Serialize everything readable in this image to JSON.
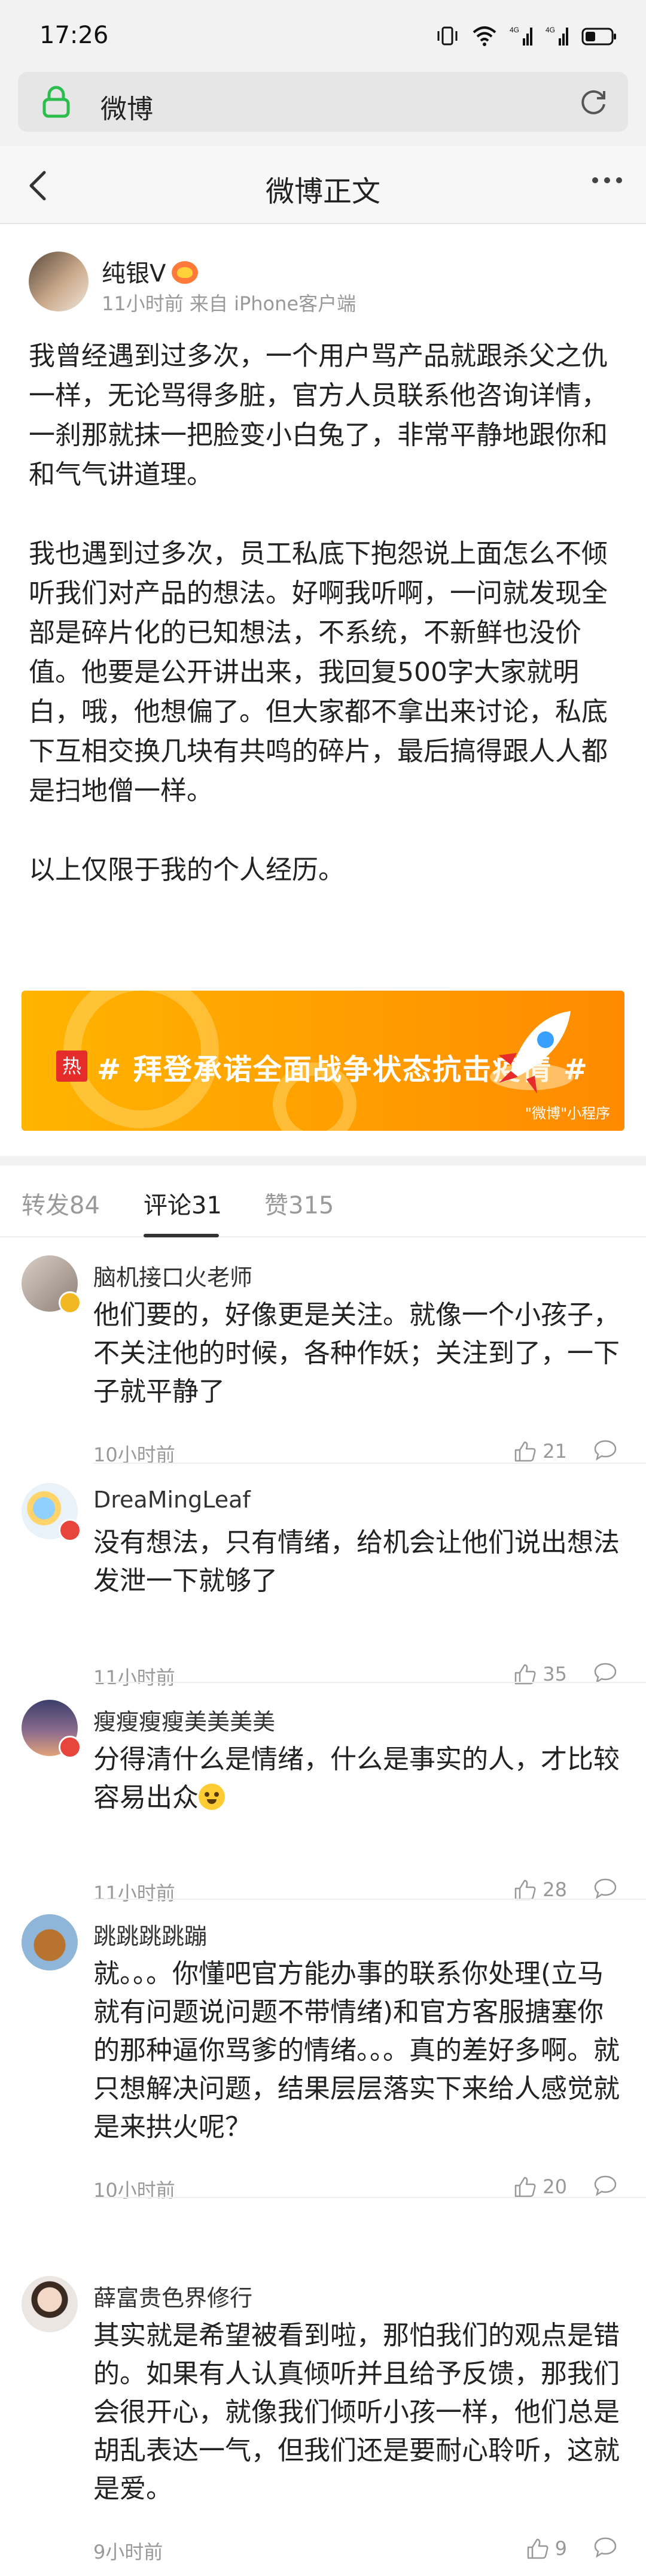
{
  "status_bar": {
    "time": "17:26",
    "signal_a": "4G",
    "signal_b": "4G"
  },
  "browser": {
    "url_text": "微博"
  },
  "nav": {
    "title": "微博正文"
  },
  "post": {
    "author": "纯银V",
    "meta": "11小时前 来自 iPhone客户端",
    "paragraphs": [
      "我曾经遇到过多次，一个用户骂产品就跟杀父之仇一样，无论骂得多脏，官方人员联系他咨询详情，一刹那就抹一把脸变小白兔了，非常平静地跟你和和气气讲道理。",
      "我也遇到过多次，员工私底下抱怨说上面怎么不倾听我们对产品的想法。好啊我听啊，一问就发现全部是碎片化的已知想法，不系统，不新鲜也没价值。他要是公开讲出来，我回复500字大家就明白，哦，他想偏了。但大家都不拿出来讨论，私底下互相交换几块有共鸣的碎片，最后搞得跟人人都是扫地僧一样。",
      "以上仅限于我的个人经历。"
    ]
  },
  "banner": {
    "hot_tag": "热",
    "text": "# 拜登承诺全面战争状态抗击疫情 #",
    "footer": "\"微博\"小程序"
  },
  "tabs": {
    "repost": "转发84",
    "comment": "评论31",
    "like": "赞315"
  },
  "comments": [
    {
      "name": "脑机接口火老师",
      "text": "他们要的，好像更是关注。就像一个小孩子，不关注他的时候，各种作妖；关注到了，一下子就平静了",
      "time": "10小时前",
      "likes": "21"
    },
    {
      "name": "DreaMingLeaf",
      "text": "没有想法，只有情绪，给机会让他们说出想法发泄一下就够了",
      "time": "11小时前",
      "likes": "35"
    },
    {
      "name": "瘦瘦瘦瘦美美美美",
      "text": "分得清什么是情绪，什么是事实的人，才比较容易出众",
      "time": "11小时前",
      "likes": "28"
    },
    {
      "name": "跳跳跳跳蹦",
      "text": "就。。。你懂吧官方能办事的联系你处理(立马就有问题说问题不带情绪)和官方客服搪塞你的那种逼你骂爹的情绪。。。真的差好多啊。就只想解决问题，结果层层落实下来给人感觉就是来拱火呢？",
      "time": "10小时前",
      "likes": "20"
    },
    {
      "name": "薛富贵色界修行",
      "text": "其实就是希望被看到啦，那怕我们的观点是错的。如果有人认真倾听并且给予反馈，那我们会很开心，就像我们倾听小孩一样，他们总是胡乱表达一气，但我们还是要耐心聆听，这就是爱。",
      "time": "9小时前",
      "likes": "9"
    }
  ],
  "colors": {
    "accent_orange": "#ff8a00",
    "badge_gold": "#f2b824",
    "badge_red": "#e8453c",
    "hot_red": "#e62b2b"
  }
}
